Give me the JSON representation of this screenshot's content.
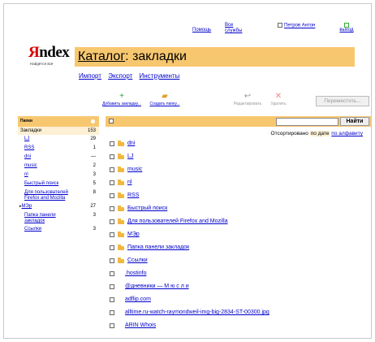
{
  "header": {
    "help": "Помощь",
    "all_services_line1": "Все",
    "all_services_line2": "службы",
    "user": "Петров Антон",
    "exit": "выход"
  },
  "logo": {
    "brand_y": "Я",
    "brand_rest": "ndex",
    "slogan": "Найдётся всё"
  },
  "title": {
    "link": "Каталог",
    "rest": ": закладки"
  },
  "subnav": [
    "Импорт",
    "Экспорт",
    "Инструменты"
  ],
  "toolbar": {
    "add_bookmark": "Добавить закладку...",
    "create_folder": "Создать папку...",
    "edit": "Редактировать",
    "delete": "Удалить",
    "move": "Переместить..."
  },
  "sidebar": {
    "header": "Папки",
    "items": [
      {
        "label": "Закладки",
        "count": "153"
      },
      {
        "label": "LJ",
        "count": "29"
      },
      {
        "label": "RSS",
        "count": "1"
      },
      {
        "label": "dni",
        "count": "—"
      },
      {
        "label": "music",
        "count": "2"
      },
      {
        "label": "nl",
        "count": "3"
      },
      {
        "label": "Быстрый поиск",
        "count": "5"
      },
      {
        "label": "Для пользователей Firefox and Mozilla",
        "count": "8"
      },
      {
        "label": "МЭр",
        "count": "27"
      },
      {
        "label": "Папка панели закладок",
        "count": "3"
      },
      {
        "label": "Ссылки",
        "count": "3"
      }
    ]
  },
  "list": {
    "find_button": "Найти",
    "sort_prefix": "Отсортировано",
    "sort_by_date": "по дате",
    "sort_alpha": "по алфавиту",
    "folders": [
      "dni",
      "LJ",
      "music",
      "nl",
      "RSS",
      "Быстрый поиск",
      "Для пользователей Firefox and Mozilla",
      "МЭр",
      "Папка панели закладок",
      "Ссылки"
    ],
    "links": [
      ".hostinfo",
      "@дневники — М ю с л и",
      "adflip.com",
      "alltime.ru-watch-raymondweil-img-big-2834-ST-00300.jpg",
      "ARIN Whois"
    ]
  }
}
